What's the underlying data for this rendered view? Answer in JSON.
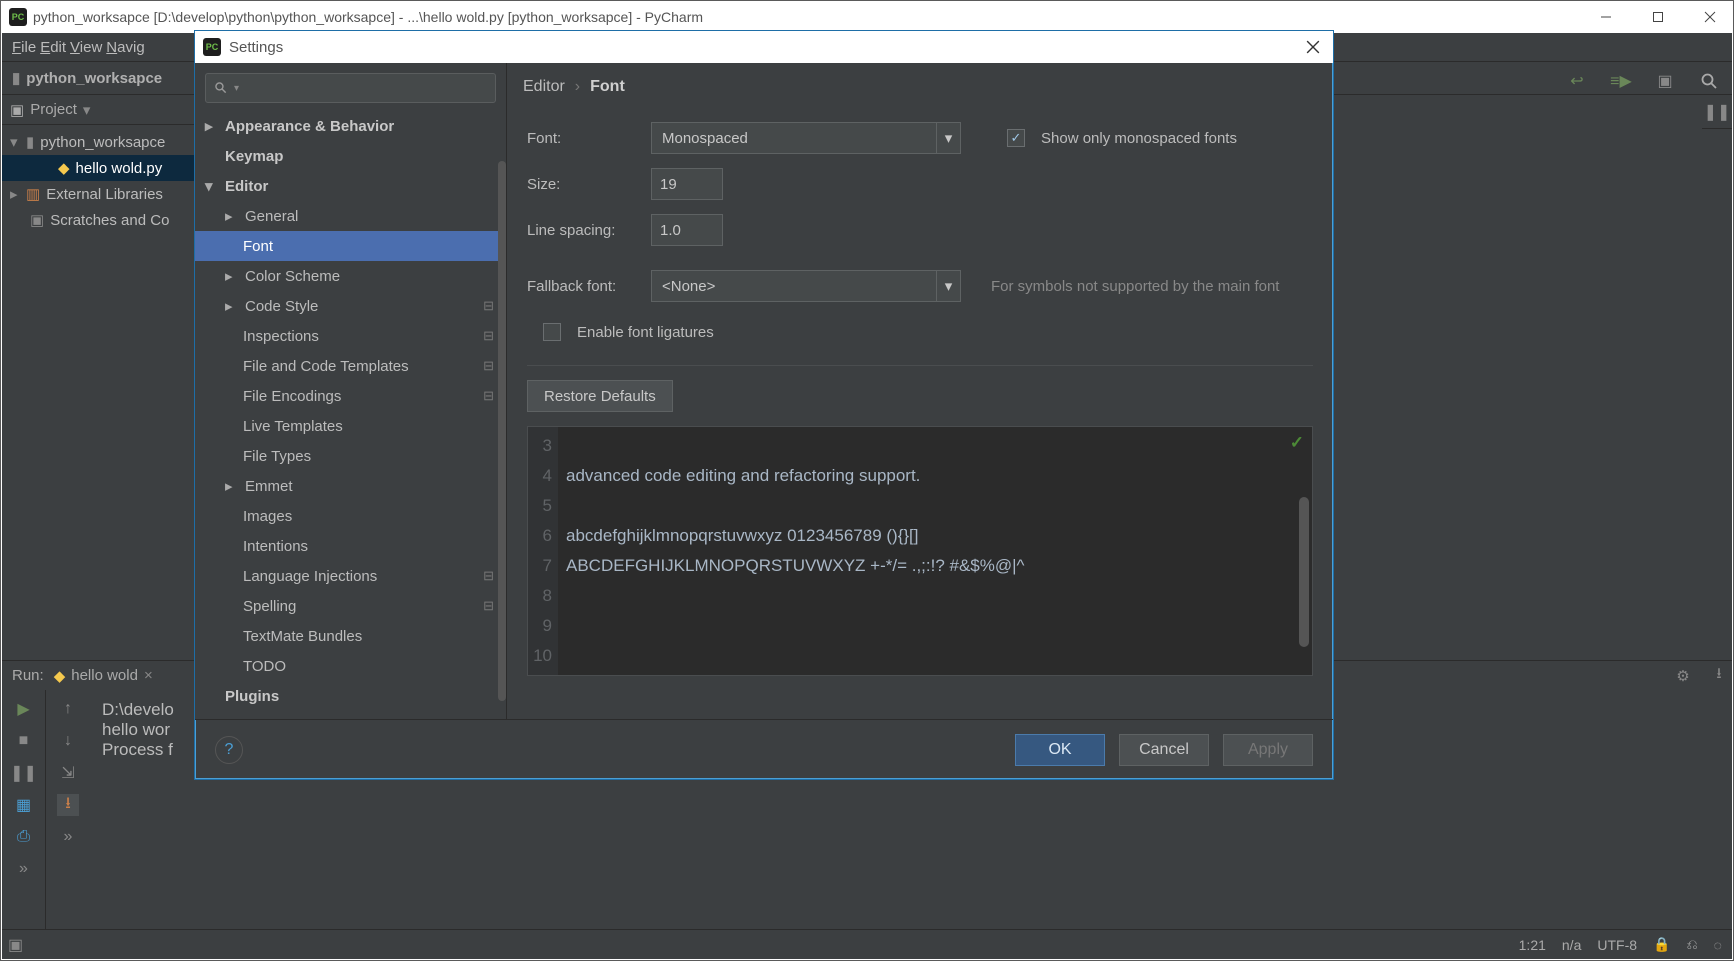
{
  "os": {
    "title": "python_worksapce [D:\\develop\\python\\python_worksapce] - ...\\hello wold.py [python_worksapce] - PyCharm"
  },
  "menubar": [
    "File",
    "Edit",
    "View",
    "Navig"
  ],
  "navbar": {
    "crumb": "python_worksapce"
  },
  "project": {
    "header": "Project",
    "root": "python_worksapce",
    "file": "hello wold.py",
    "ext_lib": "External Libraries",
    "scratches": "Scratches and Co"
  },
  "run": {
    "label": "Run:",
    "tab": "hello wold",
    "lines": [
      "D:\\develo",
      "hello wor",
      "",
      "Process f"
    ]
  },
  "status": {
    "pos": "1:21",
    "insp": "n/a",
    "enc": "UTF-8"
  },
  "settings": {
    "title": "Settings",
    "breadcrumb": {
      "parent": "Editor",
      "sep": "›",
      "current": "Font"
    },
    "search_placeholder": "",
    "tree": {
      "appearance": "Appearance & Behavior",
      "keymap": "Keymap",
      "editor": "Editor",
      "general": "General",
      "font": "Font",
      "color": "Color Scheme",
      "codestyle": "Code Style",
      "inspections": "Inspections",
      "templates": "File and Code Templates",
      "encodings": "File Encodings",
      "livet": "Live Templates",
      "ftypes": "File Types",
      "emmet": "Emmet",
      "images": "Images",
      "intentions": "Intentions",
      "lang": "Language Injections",
      "spelling": "Spelling",
      "textmate": "TextMate Bundles",
      "todo": "TODO",
      "plugins": "Plugins"
    },
    "form": {
      "font_label": "Font:",
      "font_value": "Monospaced",
      "mono_check": "Show only monospaced fonts",
      "size_label": "Size:",
      "size_value": "19",
      "ls_label": "Line spacing:",
      "ls_value": "1.0",
      "fb_label": "Fallback font:",
      "fb_value": "<None>",
      "fb_hint": "For symbols not supported by the main font",
      "ligatures": "Enable font ligatures",
      "restore": "Restore Defaults"
    },
    "preview": {
      "gutter": [
        "3",
        "4",
        "5",
        "6",
        "7",
        "8",
        "9",
        "10"
      ],
      "lines": [
        "advanced code editing and refactoring support.",
        "",
        "abcdefghijklmnopqrstuvwxyz 0123456789 (){}[]",
        "ABCDEFGHIJKLMNOPQRSTUVWXYZ +-*/= .,;:!? #&$%@|^",
        "",
        "",
        "",
        ""
      ]
    },
    "footer": {
      "ok": "OK",
      "cancel": "Cancel",
      "apply": "Apply"
    }
  }
}
